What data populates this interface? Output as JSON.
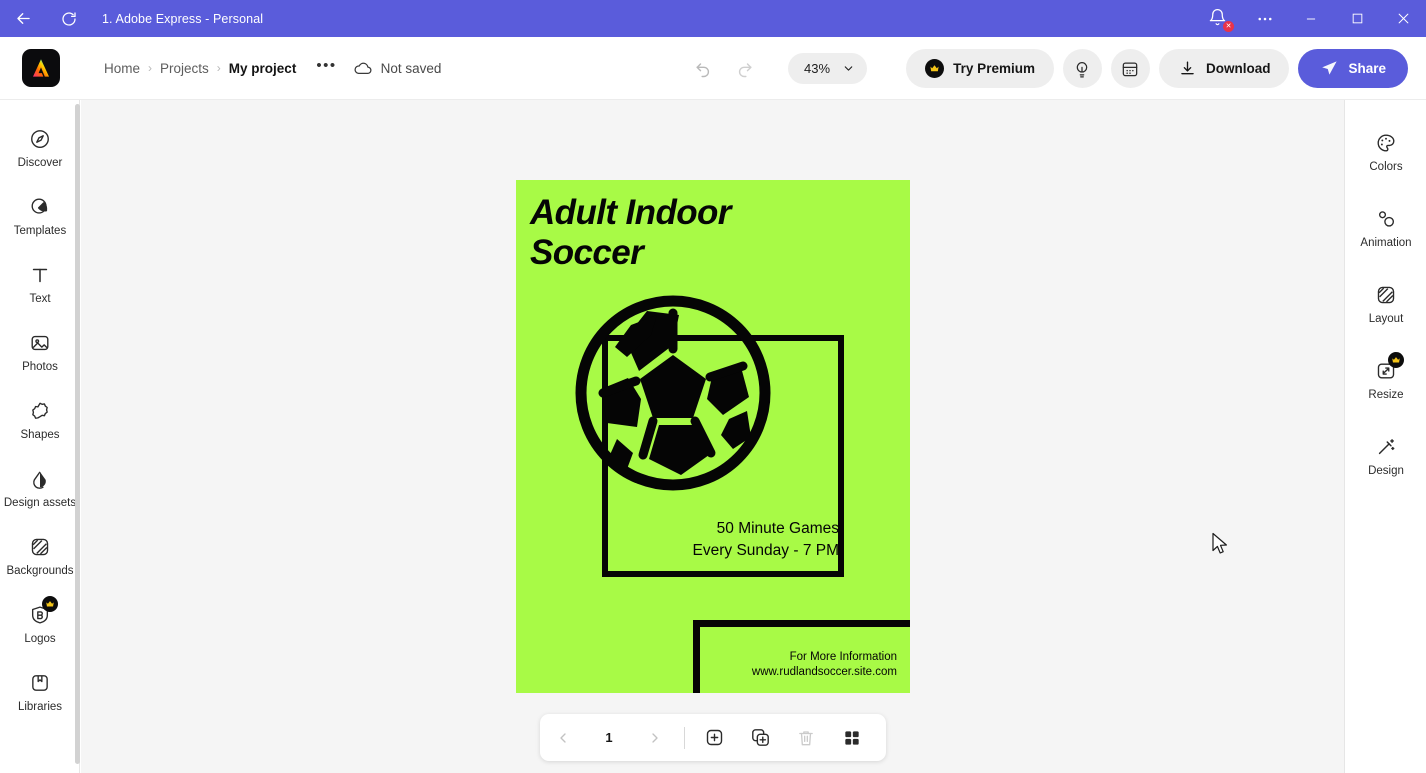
{
  "titlebar": {
    "back_icon": "back-arrow-icon",
    "refresh_icon": "refresh-icon",
    "title": "1. Adobe Express - Personal",
    "bell_icon": "notification-bell-icon",
    "bell_badge": "✕",
    "more_icon": "more-options-icon",
    "minimize_icon": "minimize-icon",
    "maximize_icon": "maximize-icon",
    "close_icon": "close-icon",
    "bg_color": "#5a5cdb"
  },
  "header": {
    "logo_icon": "adobe-express-logo",
    "breadcrumb": {
      "home": "Home",
      "projects": "Projects",
      "project": "My project",
      "separator": "›",
      "more": "•••"
    },
    "cloud_icon": "cloud-icon",
    "save_status": "Not saved",
    "undo_icon": "undo-icon",
    "redo_icon": "redo-icon",
    "zoom": {
      "value": "43%",
      "chevron_icon": "chevron-down-icon"
    },
    "try_premium": {
      "label": "Try Premium",
      "crown_icon": "crown-icon"
    },
    "ideas_icon": "lightbulb-idea-icon",
    "calendar_icon": "calendar-icon",
    "download": {
      "label": "Download",
      "icon": "download-icon"
    },
    "share": {
      "label": "Share",
      "icon": "send-plane-icon",
      "color": "#5a5cdb"
    }
  },
  "left_rail": {
    "items": [
      {
        "label": "Discover",
        "icon": "compass-icon",
        "premium": false
      },
      {
        "label": "Templates",
        "icon": "templates-icon",
        "premium": false
      },
      {
        "label": "Text",
        "icon": "text-icon",
        "premium": false
      },
      {
        "label": "Photos",
        "icon": "photos-icon",
        "premium": false
      },
      {
        "label": "Shapes",
        "icon": "shapes-icon",
        "premium": false
      },
      {
        "label": "Design assets",
        "icon": "design-assets-icon",
        "premium": false
      },
      {
        "label": "Backgrounds",
        "icon": "backgrounds-icon",
        "premium": false
      },
      {
        "label": "Logos",
        "icon": "logos-icon",
        "premium": true
      },
      {
        "label": "Libraries",
        "icon": "libraries-icon",
        "premium": false
      }
    ]
  },
  "right_rail": {
    "items": [
      {
        "label": "Colors",
        "icon": "color-palette-icon",
        "premium": false
      },
      {
        "label": "Animation",
        "icon": "animation-icon",
        "premium": false
      },
      {
        "label": "Layout",
        "icon": "layout-icon",
        "premium": false
      },
      {
        "label": "Resize",
        "icon": "resize-icon",
        "premium": true
      },
      {
        "label": "Design",
        "icon": "magic-wand-icon",
        "premium": false
      }
    ]
  },
  "canvas": {
    "background": "#f5f5f5",
    "poster": {
      "background_color": "#a8fa46",
      "title": "Adult Indoor Soccer",
      "ball_icon": "soccer-ball-graphic",
      "mid_line1": "50 Minute Games",
      "mid_line2": "Every Sunday - 7 PM",
      "bottom_line1": "For More Information",
      "bottom_line2": "www.rudlandsoccer.site.com"
    }
  },
  "page_toolbar": {
    "prev_icon": "chevron-left-icon",
    "page_number": "1",
    "next_icon": "chevron-right-icon",
    "add_page_icon": "add-page-icon",
    "duplicate_page_icon": "duplicate-page-icon",
    "delete_page_icon": "trash-icon",
    "grid_view_icon": "grid-view-icon"
  },
  "cursor": {
    "icon": "mouse-pointer-icon"
  }
}
